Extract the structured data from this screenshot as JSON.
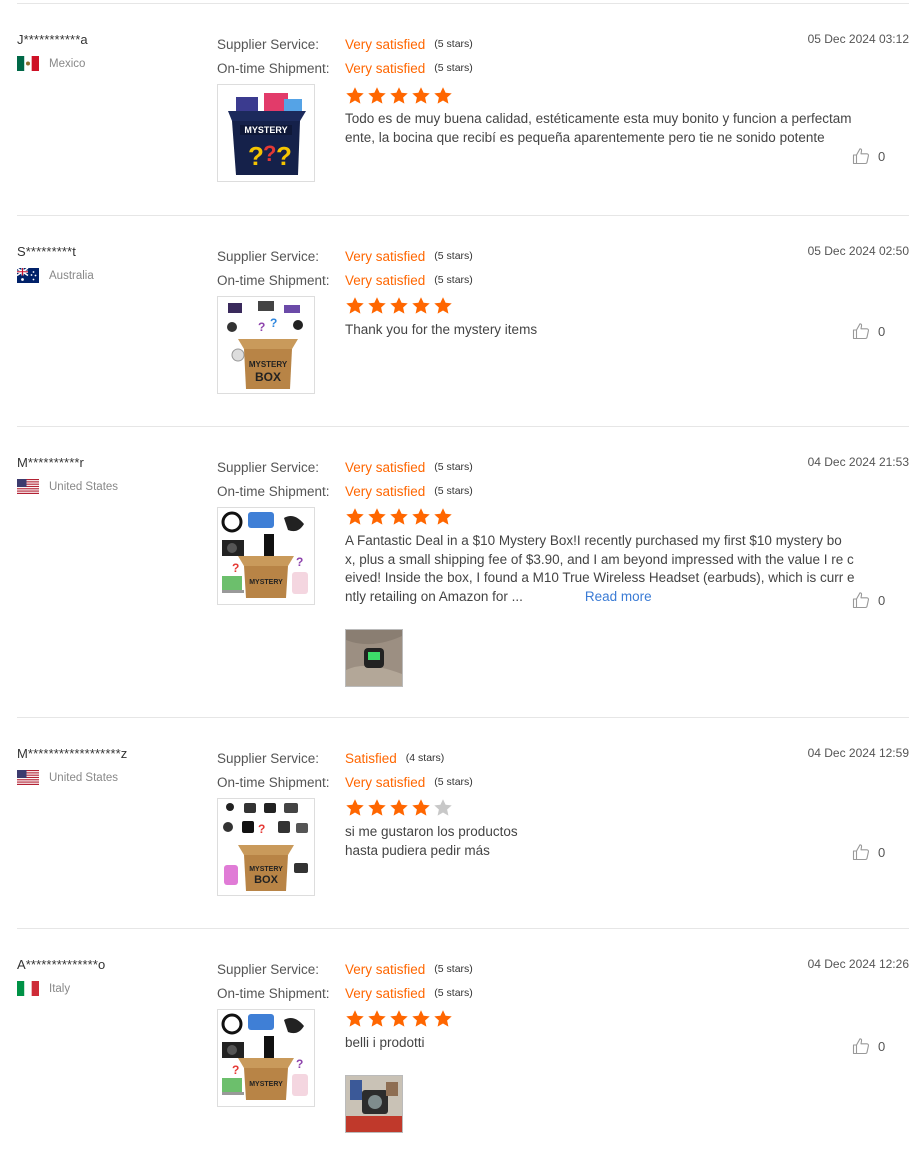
{
  "labels": {
    "supplier_service": "Supplier Service:",
    "ontime_shipment": "On-time Shipment:"
  },
  "colors": {
    "accent": "#ff6600",
    "star_off": "#c8c8c8",
    "link": "#3a7bd5"
  },
  "reviews": [
    {
      "user": "J***********a",
      "country": "Mexico",
      "flag": "mexico-flag-icon",
      "supplier_value": "Very satisfied",
      "supplier_stars": "(5 stars)",
      "shipment_value": "Very satisfied",
      "shipment_stars": "(5 stars)",
      "date": "05 Dec 2024 03:12",
      "rating": 5,
      "text": "Todo es de muy buena calidad,  estéticamente esta muy bonito  y funcion a perfectamente,  la bocina que recibí es pequeña aparentemente pero tie ne sonido potente",
      "likes": "0",
      "product_image": "mystery-box-dark-image"
    },
    {
      "user": "S*********t",
      "country": "Australia",
      "flag": "australia-flag-icon",
      "supplier_value": "Very satisfied",
      "supplier_stars": "(5 stars)",
      "shipment_value": "Very satisfied",
      "shipment_stars": "(5 stars)",
      "date": "05 Dec 2024 02:50",
      "rating": 5,
      "text": "Thank you for the mystery items",
      "likes": "0",
      "product_image": "mystery-box-kraft-image"
    },
    {
      "user": "M**********r",
      "country": "United States",
      "flag": "united-states-flag-icon",
      "supplier_value": "Very satisfied",
      "supplier_stars": "(5 stars)",
      "shipment_value": "Very satisfied",
      "shipment_stars": "(5 stars)",
      "date": "04 Dec 2024 21:53",
      "rating": 5,
      "text": "A Fantastic Deal in a $10 Mystery Box!I recently purchased my first $10 mystery bo x, plus a small shipping fee of $3.90, and I am beyond impressed with the value I re ceived! Inside the box, I found a M10 True Wireless Headset (earbuds), which is curr ently retailing on Amazon for ...",
      "read_more": "Read more",
      "likes": "0",
      "product_image": "mystery-box-electronics-image",
      "photo": "buyer-photo-earbuds-image"
    },
    {
      "user": "M******************z",
      "country": "United States",
      "flag": "united-states-flag-icon",
      "supplier_value": "Satisfied",
      "supplier_stars": "(4 stars)",
      "shipment_value": "Very satisfied",
      "shipment_stars": "(5 stars)",
      "date": "04 Dec 2024 12:59",
      "rating": 4,
      "text_lines": [
        "si me gustaron los productos",
        "hasta pudiera pedir más"
      ],
      "likes": "0",
      "product_image": "mystery-box-earbuds-image"
    },
    {
      "user": "A**************o",
      "country": "Italy",
      "flag": "italy-flag-icon",
      "supplier_value": "Very satisfied",
      "supplier_stars": "(5 stars)",
      "shipment_value": "Very satisfied",
      "shipment_stars": "(5 stars)",
      "date": "04 Dec 2024 12:26",
      "rating": 5,
      "text": "belli i prodotti",
      "likes": "0",
      "product_image": "mystery-box-electronics-image",
      "photo": "buyer-photo-gadget-image"
    }
  ]
}
